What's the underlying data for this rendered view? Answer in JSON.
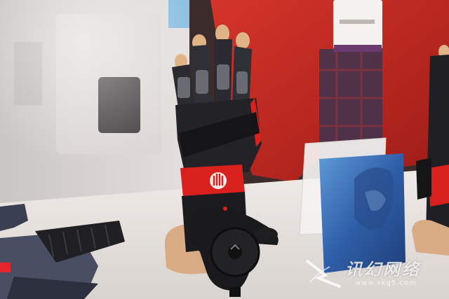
{
  "image": {
    "subject": "haptic-glove-with-vive-tracker",
    "colors": {
      "background_red": "#c52a22",
      "table": "#f2eeea",
      "glove": "#1d1d22",
      "glove_accent": "#d8201c",
      "mannequin_skin": "#d9ab84",
      "blue_card": "#2f5fa8",
      "tracker": "#1a1a1c"
    }
  },
  "watermark": {
    "text": "讯幻网络",
    "url": "www.xkg5.com"
  }
}
